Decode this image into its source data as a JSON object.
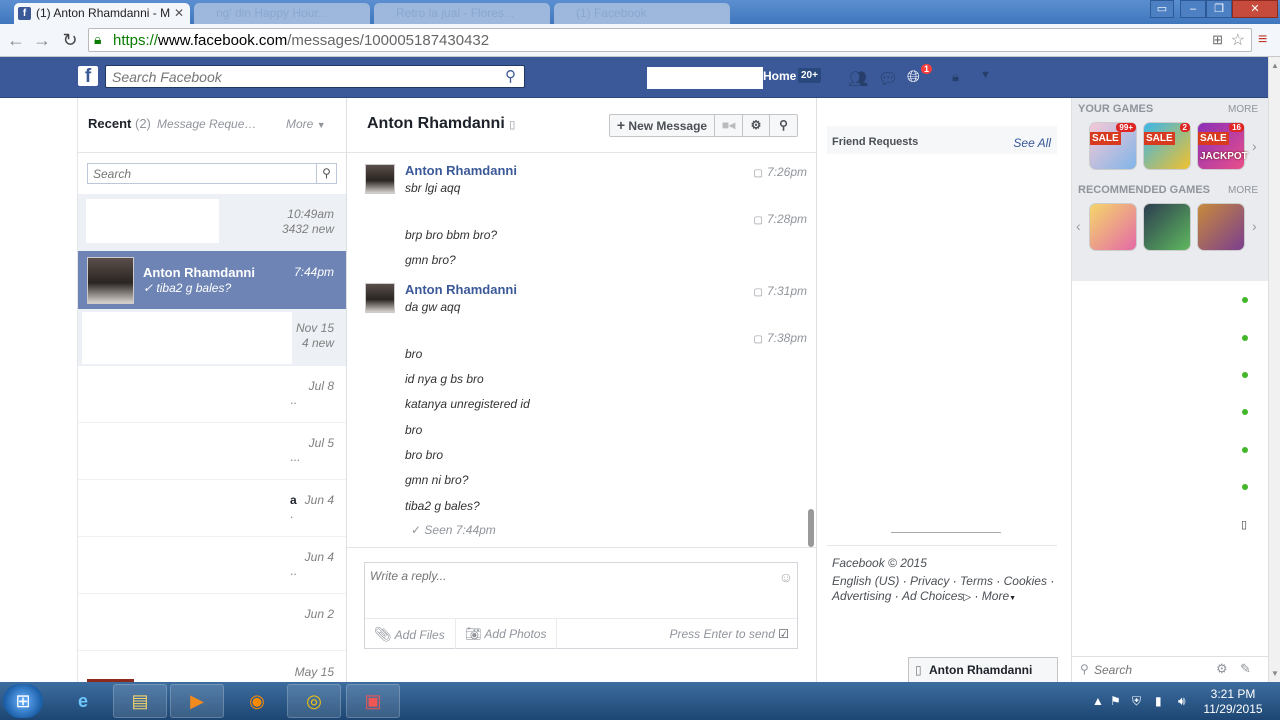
{
  "browser": {
    "tabs": [
      {
        "title": "(1) Anton Rhamdanni - M"
      },
      {
        "title": "ng' din Happy Hour..."
      },
      {
        "title": "Retro la jual - Flores..."
      },
      {
        "title": "(1) Facebook"
      }
    ],
    "url_scheme": "https://",
    "url_domain": "www.facebook.com",
    "url_path": "/messages/100005187430432"
  },
  "fb_header": {
    "logo": "f",
    "search_placeholder": "Search Facebook",
    "home_label": "Home",
    "home_count": "20+",
    "notifications_count": "1"
  },
  "inbox": {
    "recent_label": "Recent",
    "recent_count": "(2)",
    "message_requests": "Message Reque…",
    "more": "More",
    "search_placeholder": "Search",
    "threads": [
      {
        "name": "",
        "snippet": "",
        "time": "10:49am",
        "sub": "3432 new"
      },
      {
        "name": "Anton Rhamdanni",
        "snippet": "✓ tiba2 g bales?",
        "time": "7:44pm",
        "sub": ""
      },
      {
        "name": "",
        "snippet": "",
        "time": "Nov 15",
        "sub": "4 new"
      },
      {
        "name": "",
        "snippet": "..",
        "time": "Jul 8",
        "sub": ""
      },
      {
        "name": "",
        "snippet": "...",
        "time": "Jul 5",
        "sub": ""
      },
      {
        "name": "a",
        "snippet": ".",
        "time": "Jun 4",
        "sub": ""
      },
      {
        "name": "",
        "snippet": "..",
        "time": "Jun 4",
        "sub": ""
      },
      {
        "name": "",
        "snippet": "",
        "time": "Jun 2",
        "sub": ""
      },
      {
        "name": "",
        "snippet": "",
        "time": "May 15",
        "sub": ""
      }
    ]
  },
  "conversation": {
    "name": "Anton Rhamdanni",
    "new_message": "New Message",
    "groups": [
      {
        "sender": "Anton Rhamdanni",
        "time": "7:26pm",
        "messages": [
          "sbr lgi aqq"
        ]
      },
      {
        "sender": "",
        "time": "7:28pm",
        "messages": [
          "brp bro bbm bro?",
          "gmn bro?"
        ]
      },
      {
        "sender": "Anton Rhamdanni",
        "time": "7:31pm",
        "messages": [
          "da gw aqq"
        ]
      },
      {
        "sender": "",
        "time": "7:38pm",
        "messages": [
          "bro",
          "id nya g bs bro",
          "katanya unregistered id",
          "bro",
          "bro bro",
          "gmn  ni bro?",
          "tiba2 g bales?"
        ]
      }
    ],
    "seen": "Seen 7:44pm",
    "reply_placeholder": "Write a reply...",
    "add_files": "Add Files",
    "add_photos": "Add Photos",
    "press_enter": "Press Enter to send"
  },
  "right_info": {
    "friend_requests": "Friend Requests",
    "see_all": "See All",
    "copyright": "Facebook © 2015",
    "links": [
      "English (US)",
      "Privacy",
      "Terms",
      "Cookies",
      "Advertising",
      "Ad Choices",
      "More"
    ],
    "chat_tab": "Anton Rhamdanni"
  },
  "games": {
    "your_games": "YOUR GAMES",
    "recommended": "RECOMMENDED GAMES",
    "more": "MORE",
    "your_game_items": [
      {
        "tag": "SALE",
        "badge": "99+"
      },
      {
        "tag": "SALE",
        "badge": "2"
      },
      {
        "tag": "SALE",
        "badge": "16",
        "caption": "JACKPOT"
      }
    ]
  },
  "chat_sidebar": {
    "search_placeholder": "Search"
  },
  "taskbar": {
    "time": "3:21 PM",
    "date": "11/29/2015"
  }
}
